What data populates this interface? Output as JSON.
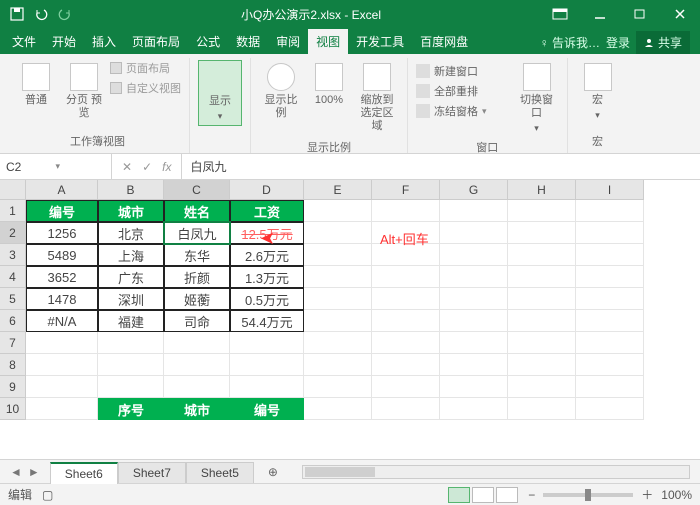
{
  "title": "小Q办公演示2.xlsx - Excel",
  "tabs": [
    "文件",
    "开始",
    "插入",
    "页面布局",
    "公式",
    "数据",
    "审阅",
    "视图",
    "开发工具",
    "百度网盘"
  ],
  "active_tab": "视图",
  "tell_me": "告诉我…",
  "login": "登录",
  "share": "共享",
  "ribbon": {
    "views": {
      "normal": "普通",
      "pagebreak": "分页\n预览",
      "pagelayout": "页面布局",
      "custom": "自定义视图",
      "group": "工作簿视图"
    },
    "show": {
      "btn": "显示",
      "group": ""
    },
    "zoom": {
      "ratio": "显示比例",
      "hundred": "100%",
      "tosel": "缩放到\n选定区域",
      "group": "显示比例"
    },
    "window": {
      "neww": "新建窗口",
      "arrange": "全部重排",
      "freeze": "冻结窗格",
      "switch": "切换窗口",
      "group": "窗口"
    },
    "macro": {
      "btn": "宏",
      "group": "宏"
    }
  },
  "namebox": "C2",
  "formula": "白凤九",
  "columns": [
    "A",
    "B",
    "C",
    "D",
    "E",
    "F",
    "G",
    "H",
    "I"
  ],
  "rows": [
    "1",
    "2",
    "3",
    "4",
    "5",
    "6",
    "7",
    "8",
    "9",
    "10"
  ],
  "table": {
    "headers": [
      "编号",
      "城市",
      "姓名",
      "工资"
    ],
    "data": [
      [
        "1256",
        "北京",
        "白凤九",
        "12.5万元"
      ],
      [
        "5489",
        "上海",
        "东华",
        "2.6万元"
      ],
      [
        "3652",
        "广东",
        "折颜",
        "1.3万元"
      ],
      [
        "1478",
        "深圳",
        "姬蘅",
        "0.5万元"
      ],
      [
        "#N/A",
        "福建",
        "司命",
        "54.4万元"
      ]
    ]
  },
  "annotation": "Alt+回车",
  "bottom_headers": [
    "序号",
    "城市",
    "编号"
  ],
  "sheets": [
    "Sheet6",
    "Sheet7",
    "Sheet5"
  ],
  "active_sheet": "Sheet6",
  "status": {
    "mode": "编辑",
    "zoom": "100%"
  }
}
